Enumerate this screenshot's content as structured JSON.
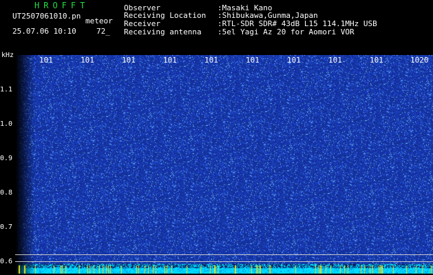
{
  "header": {
    "title": "HROFFT",
    "filename": "UT2507061010.pn",
    "mode": "meteor",
    "datetime": "25.07.06 10:10",
    "count": "72_"
  },
  "info": [
    {
      "label": "Observer",
      "value": ":Masaki Kano"
    },
    {
      "label": "Receiving Location",
      "value": ":Shibukawa,Gunma,Japan"
    },
    {
      "label": "Receiver",
      "value": ":RTL-SDR SDR# 43dB L15 114.1MHz USB"
    },
    {
      "label": "Receiving antenna",
      "value": ":5el Yagi Az 20 for Aomori VOR"
    }
  ],
  "axis": {
    "y_unit": "kHz",
    "y_ticks": [
      "1.1",
      "1.0",
      "0.9",
      "0.8",
      "0.7",
      "0.6"
    ],
    "x_ticks": [
      "101",
      "101",
      "101",
      "101",
      "101",
      "101",
      "101",
      "101",
      "101",
      "1020"
    ]
  },
  "colors": {
    "background": "#000000",
    "spectrogram_base": "#1a2a8a",
    "noise": "#3050d0",
    "band": "#00e0ff",
    "title_green": "#22dd44"
  }
}
